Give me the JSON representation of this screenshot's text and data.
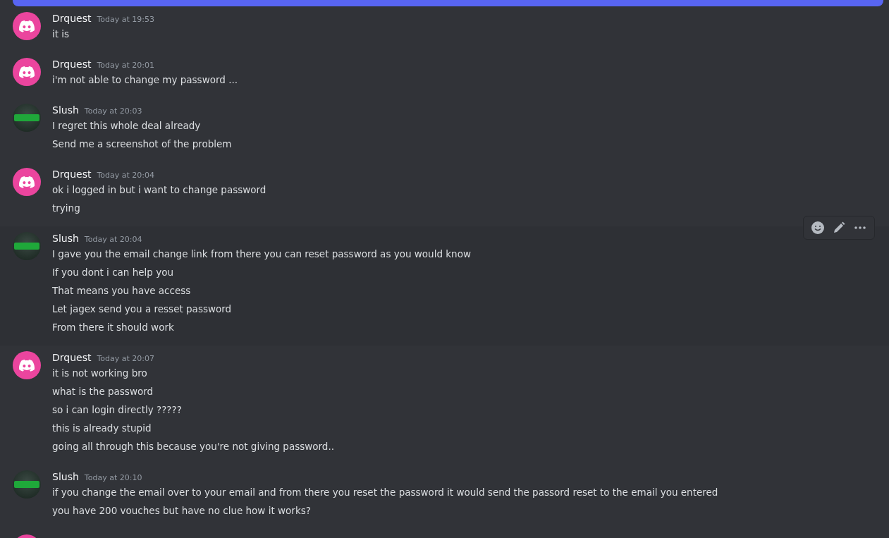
{
  "messages": [
    {
      "kind": "discord",
      "author": "Drquest",
      "time": "Today at 19:53",
      "hovered": false,
      "lines": [
        "it is"
      ]
    },
    {
      "kind": "discord",
      "author": "Drquest",
      "time": "Today at 20:01",
      "hovered": false,
      "lines": [
        "i'm not able to change my password ..."
      ]
    },
    {
      "kind": "slush",
      "author": "Slush",
      "time": "Today at 20:03",
      "hovered": false,
      "lines": [
        "I regret this whole deal already",
        "Send me a screenshot of  the problem"
      ]
    },
    {
      "kind": "discord",
      "author": "Drquest",
      "time": "Today at 20:04",
      "hovered": false,
      "lines": [
        "ok i logged in but i want to change password",
        "trying"
      ]
    },
    {
      "kind": "slush",
      "author": "Slush",
      "time": "Today at 20:04",
      "hovered": true,
      "lines": [
        "I gave you the email change link from there you can reset password as you would know",
        "If you dont i can help you",
        "That means you have access",
        "Let jagex send you a resset password",
        "From there it should work"
      ]
    },
    {
      "kind": "discord",
      "author": "Drquest",
      "time": "Today at 20:07",
      "hovered": false,
      "lines": [
        "it is not working bro",
        "what is the password",
        "so i can login directly ?????",
        "this is already stupid",
        "going all through this because you're not giving password.."
      ]
    },
    {
      "kind": "slush",
      "author": "Slush",
      "time": "Today at 20:10",
      "hovered": false,
      "lines": [
        "if you change the email over to your email and from there you reset the password it would send the passord reset to the email you entered",
        "you have 200 vouches but have no clue how it works?"
      ]
    },
    {
      "kind": "discord",
      "hovered": false
    }
  ]
}
